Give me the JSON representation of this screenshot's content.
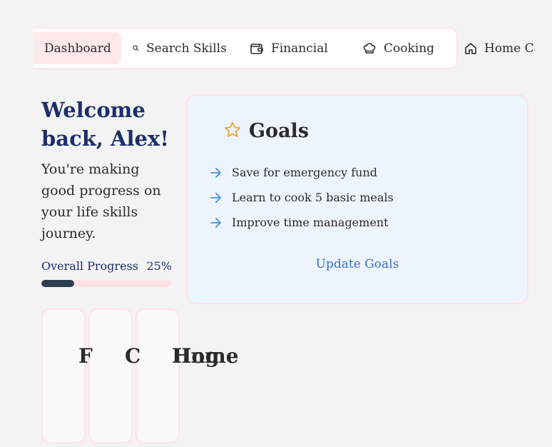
{
  "nav": {
    "items": [
      {
        "label": "Dashboard",
        "icon": "dashboard-icon",
        "active": true
      },
      {
        "label": "Search Skills",
        "icon": "search-icon"
      },
      {
        "label": "Financial",
        "icon": "wallet-icon"
      },
      {
        "label": "Cooking",
        "icon": "chef-hat-icon"
      },
      {
        "label": "Home Ca",
        "icon": "home-icon"
      }
    ]
  },
  "welcome": {
    "title": "Welcome back, Alex!",
    "subtitle": "You're making good progress on your life skills journey."
  },
  "progress": {
    "label": "Overall Progress",
    "value_text": "25%",
    "fraction": 0.25
  },
  "goals": {
    "title": "Goals",
    "items": [
      "Save for emergency fund",
      "Learn to cook 5 basic meals",
      "Improve time management"
    ],
    "update_label": "Update Goals"
  },
  "skill_tiles": [
    {
      "label": "F"
    },
    {
      "label": "C"
    },
    {
      "label": "Hng"
    },
    {
      "label": "Home"
    }
  ],
  "colors": {
    "accent": "#1d2e6b",
    "link": "#3a6fc4",
    "star": "#e0a82e",
    "arrow": "#4a8fe0",
    "progress_fill": "#2c3e50",
    "border_pink": "#fde3e6"
  }
}
